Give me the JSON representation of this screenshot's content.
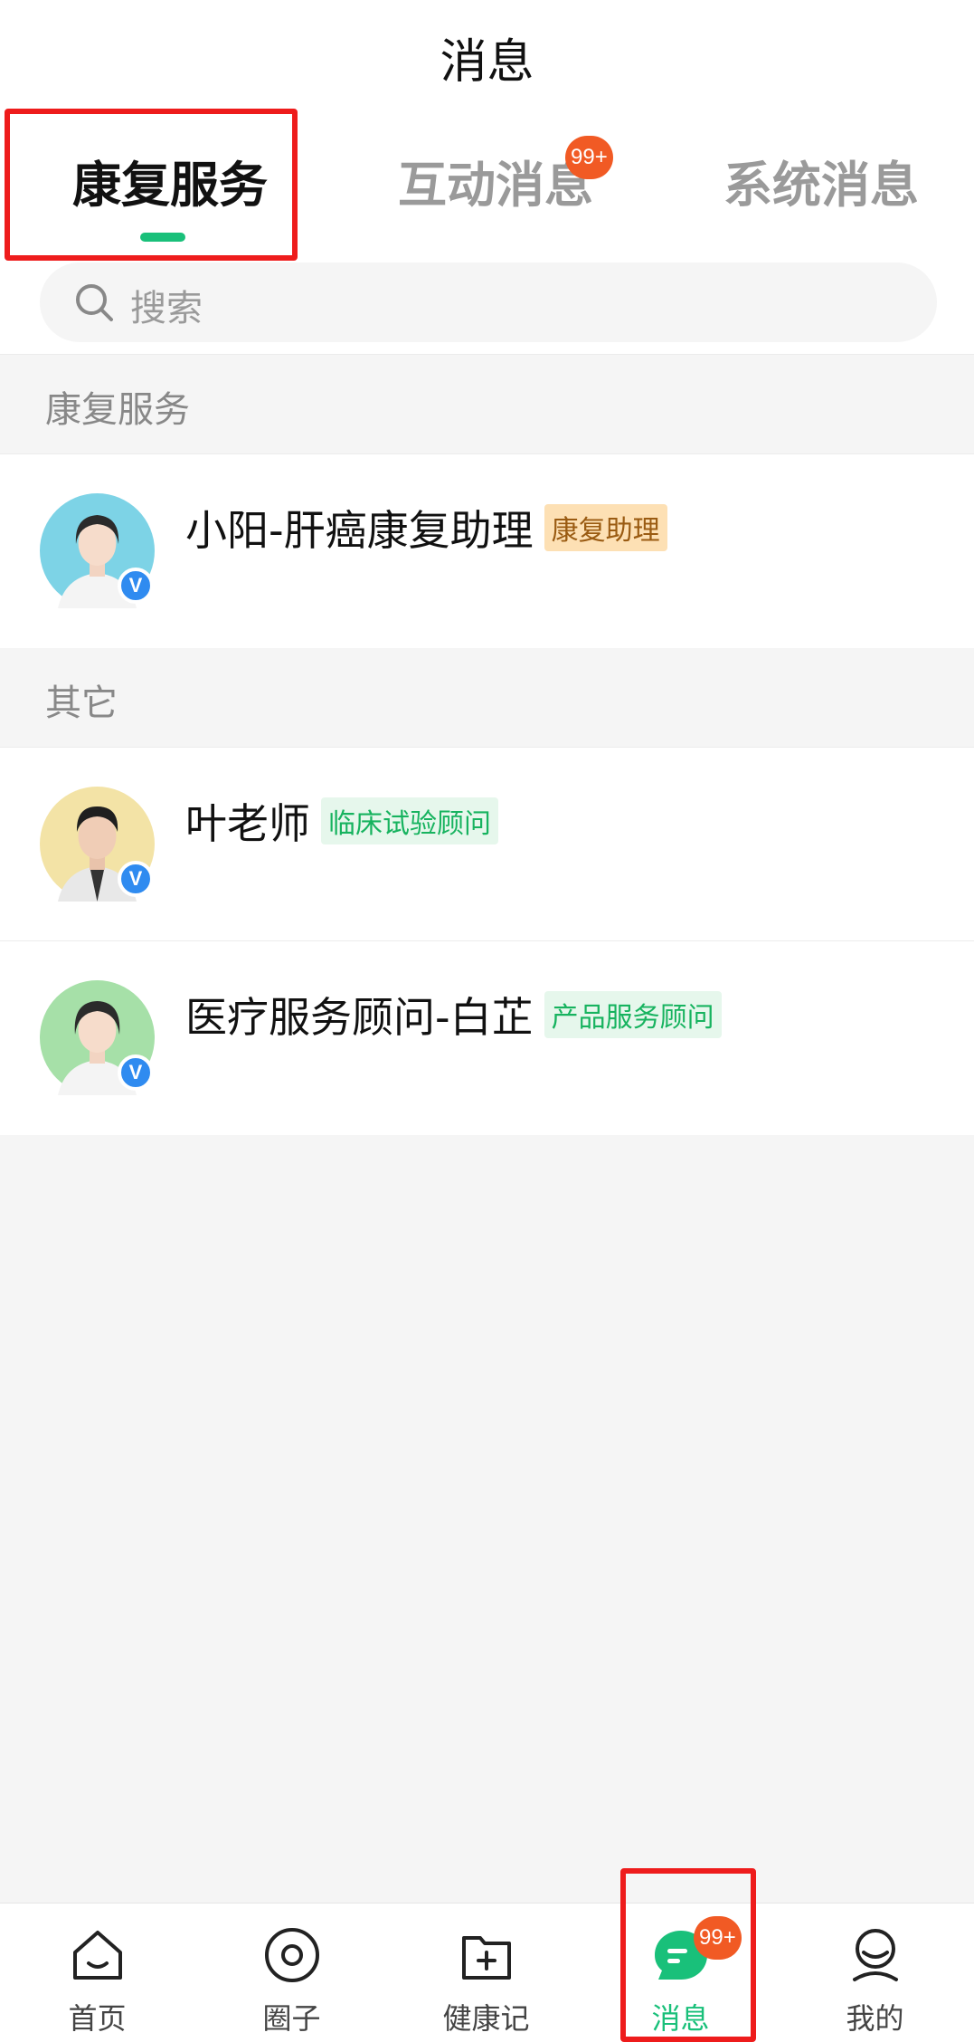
{
  "header": {
    "title": "消息",
    "tabs": [
      {
        "label": "康复服务",
        "active": true
      },
      {
        "label": "互动消息",
        "badge": "99+"
      },
      {
        "label": "系统消息"
      }
    ]
  },
  "search": {
    "placeholder": "搜索",
    "icon": "search-icon"
  },
  "sections": [
    {
      "title": "康复服务",
      "items": [
        {
          "name": "小阳-肝癌康复助理",
          "tag": "康复助理",
          "tag_color": "#fde0b4",
          "avatar_bg": "#7dd3e6",
          "verified": "V"
        }
      ]
    },
    {
      "title": "其它",
      "items": [
        {
          "name": "叶老师",
          "tag": "临床试验顾问",
          "tag_color": "#e6f7ec",
          "avatar_bg": "#f3e3a6",
          "verified": "V"
        },
        {
          "name": "医疗服务顾问-白芷",
          "tag": "产品服务顾问",
          "tag_color": "#e6f7ec",
          "avatar_bg": "#a6e0a8",
          "verified": "V"
        }
      ]
    }
  ],
  "bottom_nav": [
    {
      "label": "首页",
      "icon": "home-icon"
    },
    {
      "label": "圈子",
      "icon": "circle-icon"
    },
    {
      "label": "健康记",
      "icon": "health-folder-icon"
    },
    {
      "label": "消息",
      "icon": "message-icon",
      "active": true,
      "badge": "99+"
    },
    {
      "label": "我的",
      "icon": "profile-icon"
    }
  ],
  "colors": {
    "accent": "#19c07a",
    "badge": "#f15a24",
    "highlight": "#ee1c1c"
  }
}
